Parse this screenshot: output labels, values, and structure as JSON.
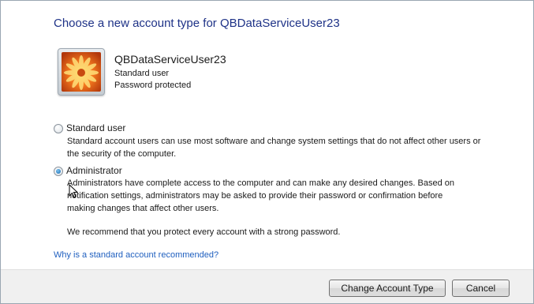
{
  "page_title": "Choose a new account type for QBDataServiceUser23",
  "user": {
    "name": "QBDataServiceUser23",
    "type": "Standard user",
    "password_status": "Password protected",
    "picture_icon": "flower-user-picture-icon"
  },
  "options": {
    "standard": {
      "label": "Standard user",
      "checked": false,
      "desc_lines": [
        "Standard account users can use most software and change system settings that do not affect other users or",
        "the security of the computer."
      ]
    },
    "administrator": {
      "label": "Administrator",
      "checked": true,
      "desc_lines": [
        "Administrators have complete access to the computer and can make any desired changes. Based on",
        "notification settings, administrators may be asked to provide their password or confirmation before",
        "making changes that affect other users."
      ]
    }
  },
  "recommendation": "We recommend that you protect every account with a strong password.",
  "help_link": "Why is a standard account recommended?",
  "buttons": {
    "change_account_type": "Change Account Type",
    "cancel": "Cancel"
  },
  "colors": {
    "title": "#1e3287",
    "link": "#1f5fbf",
    "footer_bg": "#f0f0f0"
  }
}
